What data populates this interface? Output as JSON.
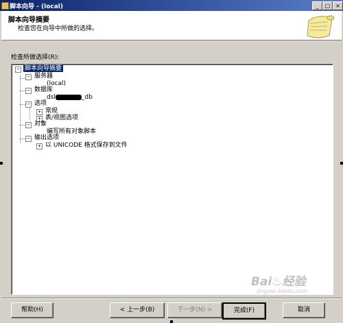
{
  "window": {
    "title": "脚本向导 - (local)"
  },
  "header": {
    "title": "脚本向导摘要",
    "subtitle": "检查您在向导中所做的选择。"
  },
  "section_label": "检查所做选择(R):",
  "tree": {
    "root": "脚本向导摘要",
    "server": "服务器",
    "server_name": "(local)",
    "database": "数据库",
    "db_prefix": "dsl",
    "db_suffix": "_db",
    "options": "选项",
    "general": "常规",
    "table_view": "表/视图选项",
    "objects": "对象",
    "objects_detail": "编写所有对象脚本",
    "output": "输出选项",
    "output_detail": "以 UNICODE 格式保存到文件"
  },
  "buttons": {
    "help": "帮助(H)",
    "back": "< 上一步(B)",
    "next": "下一步(N) >",
    "finish": "完成(F)",
    "cancel": "取消"
  },
  "watermark": {
    "brand": "Bai♨经验",
    "url": "jingyan.baidu.com"
  }
}
